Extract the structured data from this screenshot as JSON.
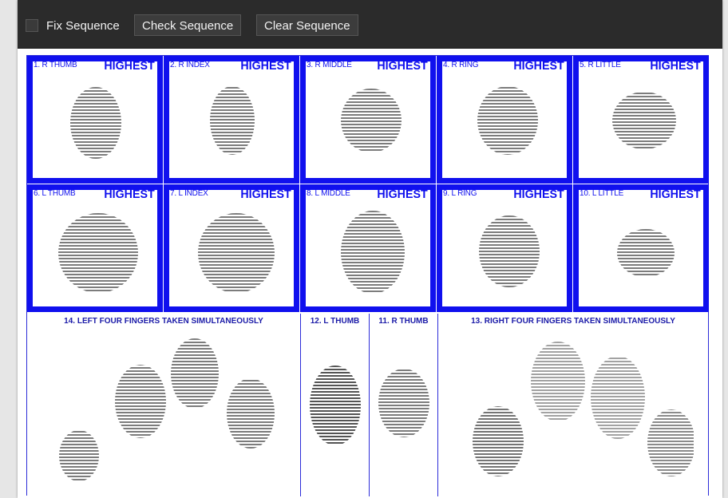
{
  "toolbar": {
    "fix_sequence_label": "Fix Sequence",
    "check_sequence_label": "Check Sequence",
    "clear_sequence_label": "Clear Sequence"
  },
  "rolled": [
    {
      "label": "1. R THUMB",
      "quality": "HIGHEST"
    },
    {
      "label": "2. R INDEX",
      "quality": "HIGHEST"
    },
    {
      "label": "3. R MIDDLE",
      "quality": "HIGHEST"
    },
    {
      "label": "4. R RING",
      "quality": "HIGHEST"
    },
    {
      "label": "5. R LITTLE",
      "quality": "HIGHEST"
    },
    {
      "label": "6. L THUMB",
      "quality": "HIGHEST"
    },
    {
      "label": "7. L INDEX",
      "quality": "HIGHEST"
    },
    {
      "label": "8. L MIDDLE",
      "quality": "HIGHEST"
    },
    {
      "label": "9. L RING",
      "quality": "HIGHEST"
    },
    {
      "label": "10. L LITTLE",
      "quality": "HIGHEST"
    }
  ],
  "slaps": {
    "left_four": "14. LEFT FOUR FINGERS TAKEN SIMULTANEOUSLY",
    "left_thumb": "12. L THUMB",
    "right_thumb": "11. R THUMB",
    "right_four": "13. RIGHT FOUR FINGERS TAKEN SIMULTANEOUSLY"
  },
  "colors": {
    "accent_blue": "#1010ee",
    "toolbar_bg": "#2b2b2b"
  }
}
